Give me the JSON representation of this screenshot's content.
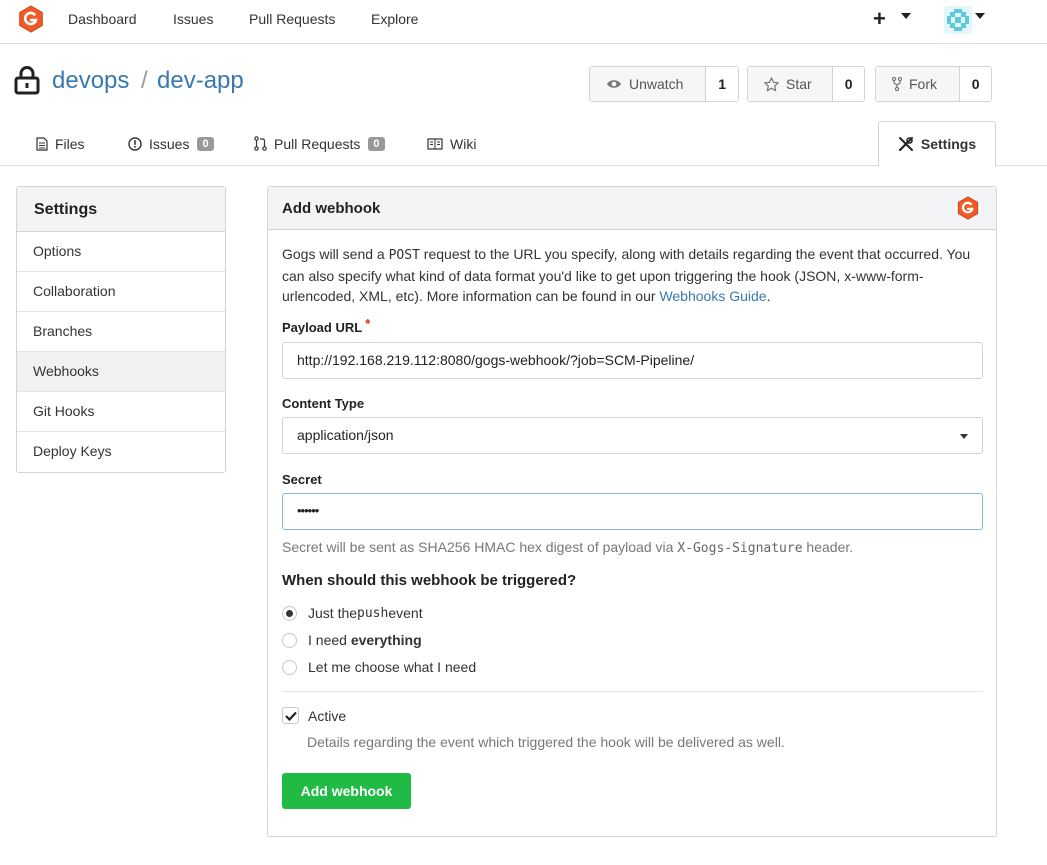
{
  "topnav": {
    "links": [
      "Dashboard",
      "Issues",
      "Pull Requests",
      "Explore"
    ]
  },
  "repo": {
    "owner": "devops",
    "separator": "/",
    "name": "dev-app",
    "watch": {
      "label": "Unwatch",
      "count": "1"
    },
    "star": {
      "label": "Star",
      "count": "0"
    },
    "fork": {
      "label": "Fork",
      "count": "0"
    }
  },
  "tabs": {
    "files": "Files",
    "issues": {
      "label": "Issues",
      "count": "0"
    },
    "pulls": {
      "label": "Pull Requests",
      "count": "0"
    },
    "wiki": "Wiki",
    "settings": "Settings"
  },
  "sidebar": {
    "title": "Settings",
    "items": [
      "Options",
      "Collaboration",
      "Branches",
      "Webhooks",
      "Git Hooks",
      "Deploy Keys"
    ],
    "active": "Webhooks"
  },
  "form": {
    "title": "Add webhook",
    "intro_1": "Gogs will send a ",
    "intro_post": "POST",
    "intro_2": " request to the URL you specify, along with details regarding the event that occurred. You can also specify what kind of data format you'd like to get upon triggering the hook (JSON, x-www-form-urlencoded, XML, etc). More information can be found in our ",
    "intro_link": "Webhooks Guide",
    "intro_3": ".",
    "payload_label": "Payload URL",
    "payload_required": "*",
    "payload_value": "http://192.168.219.112:8080/gogs-webhook/?job=SCM-Pipeline/",
    "content_type_label": "Content Type",
    "content_type_value": "application/json",
    "secret_label": "Secret",
    "secret_value": "••••••",
    "secret_help_1": "Secret will be sent as SHA256 HMAC hex digest of payload via ",
    "secret_help_code": "X-Gogs-Signature",
    "secret_help_2": " header.",
    "trigger_question": "When should this webhook be triggered?",
    "trigger_push_1": "Just the ",
    "trigger_push_code": "push",
    "trigger_push_2": " event",
    "trigger_everything_1": "I need ",
    "trigger_everything_bold": "everything",
    "trigger_choose": "Let me choose what I need",
    "trigger_selected": "push",
    "active_label": "Active",
    "active_checked": true,
    "active_help": "Details regarding the event which triggered the hook will be delivered as well.",
    "submit_label": "Add webhook"
  },
  "colors": {
    "link": "#3a78b0",
    "submit": "#21ba45",
    "gogs_logo": "#f05a28",
    "badge": "#999999"
  }
}
